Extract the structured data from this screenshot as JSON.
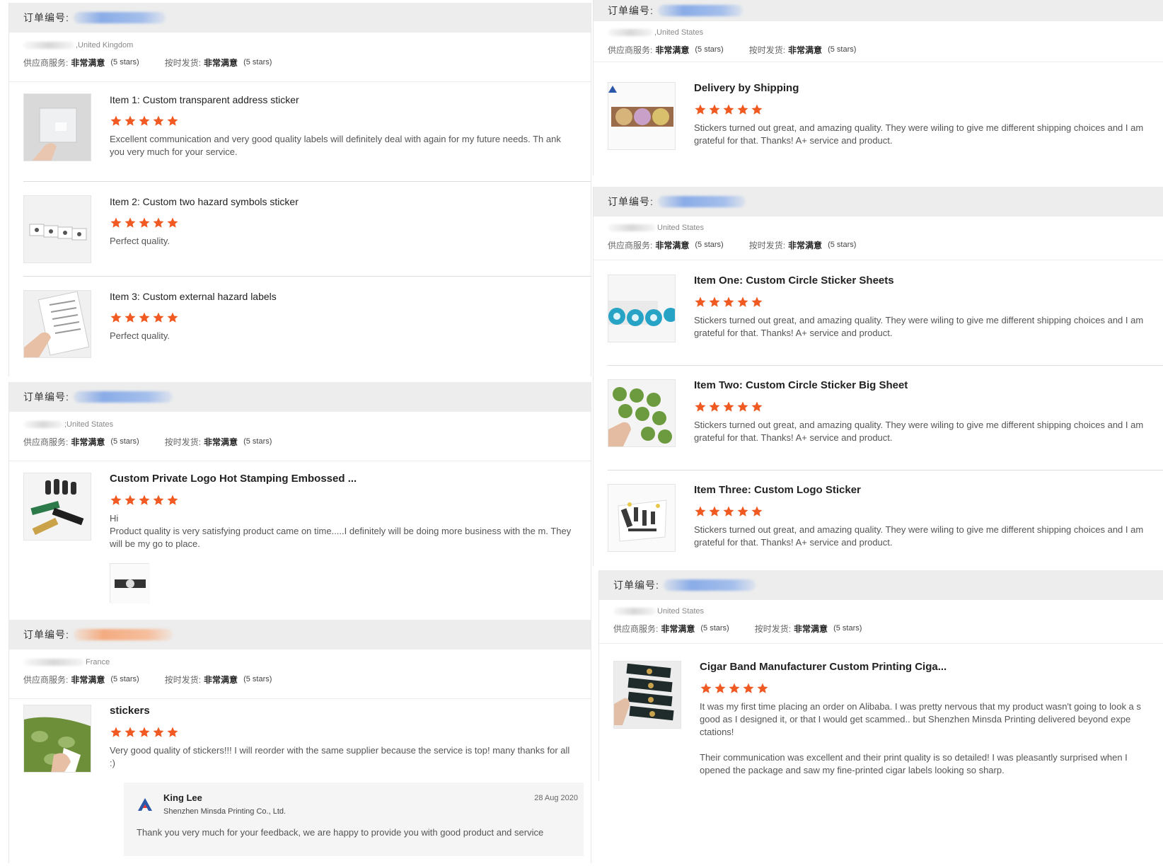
{
  "labels": {
    "order_no": "订单编号:",
    "supplier_service": "供应商服务:",
    "on_time": "按时发货:",
    "very_satisfied": "非常满意",
    "stars5": "(5 stars)"
  },
  "colors": {
    "star": "#f05a22",
    "header_bg": "#ededed",
    "reply_bg": "#f5f5f5"
  },
  "orders": [
    {
      "order_no_visible": "4 77367",
      "location": ",United Kingdom",
      "reviews": [
        {
          "title": "Item 1: Custom transparent address sticker",
          "text": "Excellent communication and very good quality labels will definitely deal with again for my future needs. Th ank you very much for your service.",
          "image": "transparent-sticker-photo",
          "rating": 5
        },
        {
          "title": "Item 2: Custom two hazard symbols sticker",
          "text": "Perfect quality.",
          "image": "hazard-symbol-stickers-photo",
          "rating": 5
        },
        {
          "title": "Item 3: Custom external hazard labels",
          "text": "Perfect quality.",
          "image": "hazard-labels-sheet-photo",
          "rating": 5
        }
      ]
    },
    {
      "order_no_visible": "1 2",
      "location": ";United States",
      "reviews": [
        {
          "title": "Custom Private Logo Hot Stamping Embossed ...",
          "text_line1": "Hi",
          "text": "Product quality is very satisfying product came on time.....I definitely will be doing more business with the m. They will be my go to place.",
          "image": "hot-stamping-labels-photo",
          "attachment": "buyer-photo-attachment",
          "rating": 5
        }
      ]
    },
    {
      "order_no_visible": "",
      "location": "France",
      "reviews": [
        {
          "title": "stickers",
          "text": "Very good quality of stickers!!! I will reorder with the same supplier because the service is top! many thanks for all :)",
          "image": "green-stickers-photo",
          "rating": 5
        }
      ],
      "reply": {
        "name": "King Lee",
        "company": "Shenzhen Minsda Printing Co., Ltd.",
        "date": "28 Aug 2020",
        "text": "Thank you very much for your feedback,  we are happy to provide you with good product and service"
      }
    },
    {
      "order_no_visible": "",
      "location": ",United States",
      "reviews": [
        {
          "title": "Delivery by Shipping",
          "text": "Stickers turned out great, and amazing quality. They were wiling to give me different shipping choices and I am grateful for that. Thanks! A+ service and product.",
          "image": "holographic-stickers-photo",
          "rating": 5
        }
      ]
    },
    {
      "order_no_visible": "",
      "location": "United States",
      "reviews": [
        {
          "title": "Item One: Custom Circle Sticker Sheets",
          "text": "Stickers turned out great, and amazing quality. They were wiling to give me different shipping choices and I am grateful for that. Thanks! A+ service and product.",
          "image": "blue-circle-stickers-photo",
          "rating": 5
        },
        {
          "title": "Item Two: Custom Circle Sticker Big Sheet",
          "text": "Stickers turned out great, and amazing quality. They were wiling to give me different shipping choices and I am grateful for that. Thanks! A+ service and product.",
          "image": "green-circle-stickers-photo",
          "rating": 5
        },
        {
          "title": "Item Three: Custom Logo Sticker",
          "text": "Stickers turned out great, and amazing quality. They were wiling to give me different shipping choices and I am grateful for that. Thanks! A+ service and product.",
          "image": "logo-sticker-photo",
          "rating": 5
        }
      ]
    },
    {
      "order_no_visible": "",
      "location": "United States",
      "reviews": [
        {
          "title": "Cigar Band Manufacturer Custom Printing Ciga...",
          "text": "It was my first time placing an order on Alibaba. I was pretty nervous that my product wasn't going to look a s good as I designed it, or that I would get scammed.. but Shenzhen Minsda Printing delivered beyond expe ctations!",
          "text2": "Their communication was excellent and their print quality is so detailed! I was pleasantly surprised when I opened the package and saw my fine-printed cigar labels looking so sharp.",
          "image": "cigar-bands-photo",
          "rating": 5
        }
      ]
    }
  ]
}
